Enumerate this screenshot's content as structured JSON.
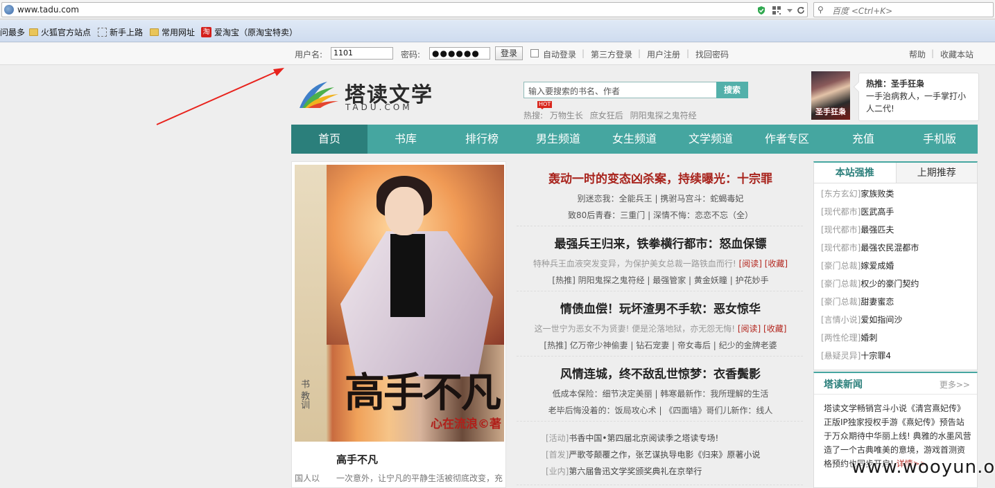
{
  "browser": {
    "url": "www.tadu.com",
    "search_placeholder": "百度 <Ctrl+K>",
    "bookmarks": [
      "问最多",
      "火狐官方站点",
      "新手上路",
      "常用网址",
      "爱淘宝（原淘宝特卖）"
    ]
  },
  "topbar": {
    "username_label": "用户名:",
    "username_value": "1101",
    "password_label": "密码:",
    "password_value": "●●●●●●",
    "login_button": "登录",
    "auto_login": "自动登录",
    "third_party": "第三方登录",
    "register": "用户注册",
    "recover": "找回密码",
    "help": "帮助",
    "favorite": "收藏本站"
  },
  "header": {
    "logo_cn": "塔读文学",
    "logo_en": "TADU.COM",
    "search_placeholder": "输入要搜索的书名、作者",
    "search_button": "搜索",
    "hot_badge": "HOT",
    "hot_label": "热搜:",
    "hot_words": [
      "万物生长",
      "庶女狂后",
      "阴阳鬼探之鬼符经"
    ],
    "promo_image_text": "圣手狂枭",
    "promo_title": "热推：圣手狂枭",
    "promo_text": "一手治病救人，一手掌打小人二代!"
  },
  "nav": [
    "首页",
    "书库",
    "排行榜",
    "男生频道",
    "女生频道",
    "文学频道",
    "作者专区",
    "充值",
    "手机版"
  ],
  "feature": {
    "strip_text": "书 教训",
    "cover_title": "高手不凡",
    "cover_author": "心在流浪©著",
    "book_name": "高手不凡",
    "side_text": "国人以",
    "desc": "一次意外，让宁凡的平静生活被彻底改变，充"
  },
  "stories": [
    {
      "title": "轰动一时的变态凶杀案，持续曝光：十宗罪",
      "line1": "别迷恋我：全能兵王 | 携驸马宫斗：蛇蝎毒妃",
      "line2": "致80后青春：三重门 | 深情不悔：恋恋不忘（全）"
    },
    {
      "title": "最强兵王归来，铁拳横行都市：怒血保镖",
      "desc": "特种兵王血液突发变异，为保护美女总裁一路铁血而行!",
      "read": "[阅读]",
      "collect": "[收藏]",
      "line2": "[热推] 阴阳鬼探之鬼符经 | 最强管家 | 黄金妖瞳 | 护花妙手"
    },
    {
      "title": "情债血偿！玩坏渣男不手软：恶女惊华",
      "desc": "这一世宁为恶女不为贤妻! 便是沦落地狱，亦无怨无悔!",
      "read": "[阅读]",
      "collect": "[收藏]",
      "line2": "[热推] 亿万帝少神偷妻 | 钻石宠妻 | 帝女毒后 | 纪少的金牌老婆"
    },
    {
      "title": "风情连城，终不敌乱世惊梦：衣香鬓影",
      "line1": "低成本保险：细节决定美丽 | 韩寒最新作：我所理解的生活",
      "line2": "老毕后悔没着的：饭局攻心术 | 《四面墙》哥们儿新作：线人"
    }
  ],
  "news_list": [
    {
      "tag": "[活动]",
      "text": "书香中国•第四届北京阅读季之塔读专场!"
    },
    {
      "tag": "[首发]",
      "text": "严歌苓颠覆之作，张艺谋执导电影《归来》原著小说"
    },
    {
      "tag": "[业内]",
      "text": "第六届鲁迅文学奖颁奖典礼在京举行"
    }
  ],
  "rank": {
    "tab_active": "本站强推",
    "tab_other": "上期推荐",
    "items": [
      {
        "cat": "[东方玄幻]",
        "name": "家族败类"
      },
      {
        "cat": "[现代都市]",
        "name": "医武高手"
      },
      {
        "cat": "[现代都市]",
        "name": "最强匹夫"
      },
      {
        "cat": "[现代都市]",
        "name": "最强农民混都市"
      },
      {
        "cat": "[豪门总裁]",
        "name": "嫁爱成婚"
      },
      {
        "cat": "[豪门总裁]",
        "name": "权少的豪门契约"
      },
      {
        "cat": "[豪门总裁]",
        "name": "甜妻蜜恋"
      },
      {
        "cat": "[言情小说]",
        "name": "爱如指间沙"
      },
      {
        "cat": "[两性伦理]",
        "name": "婚刺"
      },
      {
        "cat": "[悬疑灵异]",
        "name": "十宗罪4"
      }
    ]
  },
  "site_news": {
    "title": "塔读新闻",
    "more": "更多>>",
    "text": "塔读文学畅销宫斗小说《清宫熹妃传》正版IP独家授权手游《熹妃传》预告站于万众期待中华丽上线! 典雅的水墨风营造了一个古典唯美的意境，游戏首测资格预约也同步开启!",
    "detail": "详情>>"
  },
  "watermark": "www.wooyun.org",
  "colors": {
    "teal": "#45a6a0",
    "teal_dark": "#2b7f7b",
    "red": "#b3261e",
    "arrow": "#e8231d"
  }
}
